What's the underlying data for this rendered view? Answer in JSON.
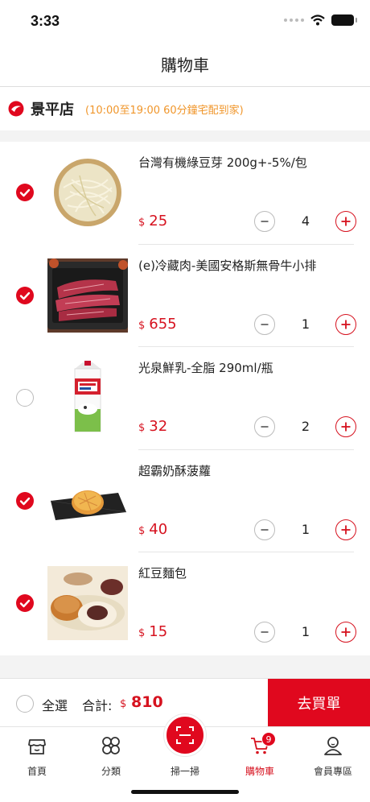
{
  "status_bar": {
    "time": "3:33"
  },
  "header": {
    "title": "購物車"
  },
  "store": {
    "name": "景平店",
    "hours": "(10:00至19:00  60分鐘宅配到家)"
  },
  "cart": {
    "items": [
      {
        "name": "台灣有機綠豆芽 200g+-5%/包",
        "currency": "$",
        "price": "25",
        "quantity": "4",
        "checked": true,
        "image": "bean-sprouts"
      },
      {
        "name": "(e)冷藏肉-美國安格斯無骨牛小排",
        "currency": "$",
        "price": "655",
        "quantity": "1",
        "checked": true,
        "image": "beef-short-rib"
      },
      {
        "name": "光泉鮮乳-全脂 290ml/瓶",
        "currency": "$",
        "price": "32",
        "quantity": "2",
        "checked": false,
        "image": "milk-carton"
      },
      {
        "name": "超霸奶酥菠蘿",
        "currency": "$",
        "price": "40",
        "quantity": "1",
        "checked": true,
        "image": "pineapple-bun"
      },
      {
        "name": "紅豆麵包",
        "currency": "$",
        "price": "15",
        "quantity": "1",
        "checked": true,
        "image": "red-bean-bun"
      }
    ]
  },
  "checkout": {
    "select_all": "全選",
    "total_label": "合計:",
    "total_currency": "$",
    "total_value": "810",
    "button": "去買單"
  },
  "tabs": [
    {
      "label": "首頁",
      "icon": "store-icon"
    },
    {
      "label": "分類",
      "icon": "grid-icon"
    },
    {
      "label": "掃一掃",
      "icon": "scan-icon"
    },
    {
      "label": "購物車",
      "icon": "cart-icon",
      "badge": "9",
      "active": true
    },
    {
      "label": "會員專區",
      "icon": "user-icon"
    }
  ],
  "colors": {
    "accent": "#e0081e",
    "price": "#d6121f",
    "store_hours": "#f0962b"
  }
}
